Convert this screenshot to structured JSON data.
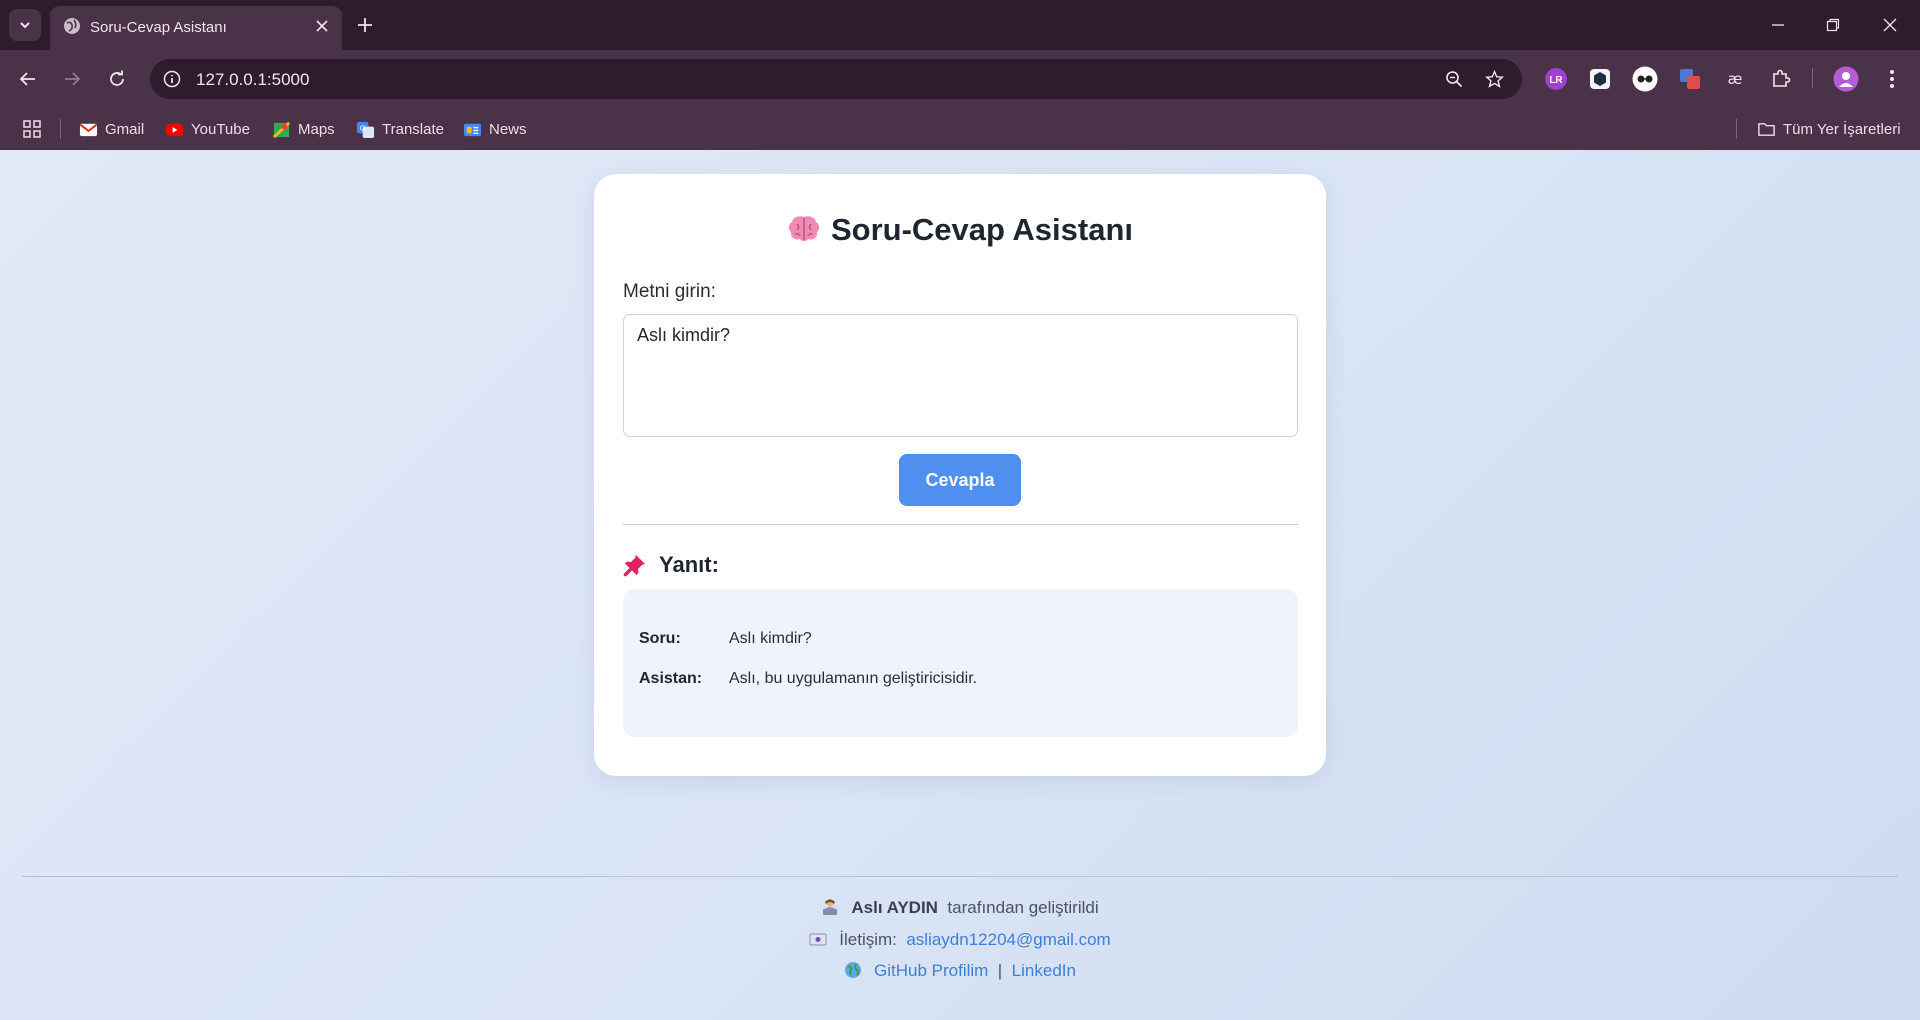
{
  "browser": {
    "tab": {
      "title": "Soru-Cevap Asistanı"
    },
    "address_bar": {
      "url": "127.0.0.1:5000"
    },
    "bookmarks": [
      {
        "label": "Gmail",
        "icon": "gmail-icon"
      },
      {
        "label": "YouTube",
        "icon": "youtube-icon"
      },
      {
        "label": "Maps",
        "icon": "maps-icon"
      },
      {
        "label": "Translate",
        "icon": "translate-icon"
      },
      {
        "label": "News",
        "icon": "news-icon"
      }
    ],
    "all_bookmarks_label": "Tüm Yer İşaretleri"
  },
  "app": {
    "title": "Soru-Cevap Asistanı",
    "title_icon": "brain-icon",
    "input_label": "Metni girin:",
    "input_value": "Aslı kimdir?",
    "submit_label": "Cevapla",
    "answer_heading": "Yanıt:",
    "answer_icon": "pin-icon",
    "qa": {
      "question_key": "Soru:",
      "question_value": "Aslı kimdir?",
      "answer_key": "Asistan:",
      "answer_value": "Aslı, bu uygulamanın geliştiricisidir."
    }
  },
  "footer": {
    "author_name": "Aslı AYDIN",
    "author_suffix": "tarafından geliştirildi",
    "contact_label": "İletişim:",
    "email": "asliaydn12204@gmail.com",
    "github_label": "GitHub Profilim",
    "link_separator": "|",
    "linkedin_label": "LinkedIn"
  },
  "colors": {
    "accent": "#4f8ff0",
    "link": "#3d7fd6",
    "chrome_dark": "#2d1b2e",
    "chrome": "#4a3249"
  }
}
